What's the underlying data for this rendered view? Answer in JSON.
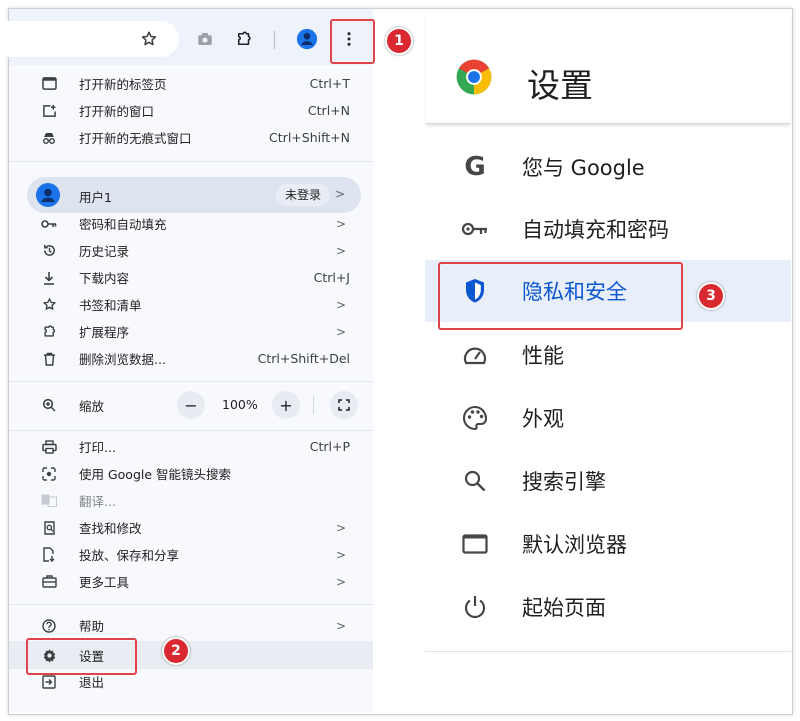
{
  "menu": {
    "items": [
      {
        "label": "打开新的标签页",
        "shortcut": "Ctrl+T",
        "icon": "new-tab-icon"
      },
      {
        "label": "打开新的窗口",
        "shortcut": "Ctrl+N",
        "icon": "new-window-icon"
      },
      {
        "label": "打开新的无痕式窗口",
        "shortcut": "Ctrl+Shift+N",
        "icon": "incognito-icon"
      }
    ],
    "profile": {
      "label": "用户1",
      "status": "未登录",
      "arrow": ">"
    },
    "group2": [
      {
        "label": "密码和自动填充",
        "icon": "key-icon"
      },
      {
        "label": "历史记录",
        "icon": "history-icon"
      },
      {
        "label": "下载内容",
        "shortcut": "Ctrl+J",
        "icon": "download-icon"
      },
      {
        "label": "书签和清单",
        "icon": "star-icon"
      },
      {
        "label": "扩展程序",
        "icon": "puzzle-icon"
      },
      {
        "label": "删除浏览数据...",
        "shortcut": "Ctrl+Shift+Del",
        "icon": "trash-icon"
      }
    ],
    "zoom": {
      "label": "缩放",
      "minus": "−",
      "value": "100%",
      "plus": "+"
    },
    "group3": [
      {
        "label": "打印...",
        "shortcut": "Ctrl+P",
        "icon": "print-icon"
      },
      {
        "label": "使用 Google 智能镜头搜索",
        "icon": "lens-icon"
      },
      {
        "label": "翻译...",
        "icon": "translate-icon"
      },
      {
        "label": "查找和修改",
        "icon": "find-icon"
      },
      {
        "label": "投放、保存和分享",
        "icon": "cast-icon"
      },
      {
        "label": "更多工具",
        "icon": "toolbox-icon"
      }
    ],
    "group4": [
      {
        "label": "帮助",
        "icon": "help-icon"
      },
      {
        "label": "设置",
        "icon": "gear-icon"
      },
      {
        "label": "退出",
        "icon": "exit-icon"
      }
    ]
  },
  "settings": {
    "title": "设置",
    "items": [
      {
        "label": "您与 Google",
        "icon": "google-g-icon"
      },
      {
        "label": "自动填充和密码",
        "icon": "key-icon"
      },
      {
        "label": "隐私和安全",
        "icon": "shield-icon"
      },
      {
        "label": "性能",
        "icon": "speedometer-icon"
      },
      {
        "label": "外观",
        "icon": "palette-icon"
      },
      {
        "label": "搜索引擎",
        "icon": "search-icon"
      },
      {
        "label": "默认浏览器",
        "icon": "browser-window-icon"
      },
      {
        "label": "起始页面",
        "icon": "power-icon"
      }
    ]
  },
  "badges": [
    "1",
    "2",
    "3"
  ],
  "colors": {
    "accent": "#0b57d0",
    "highlight": "#e0444b",
    "badge": "#d9282f"
  }
}
